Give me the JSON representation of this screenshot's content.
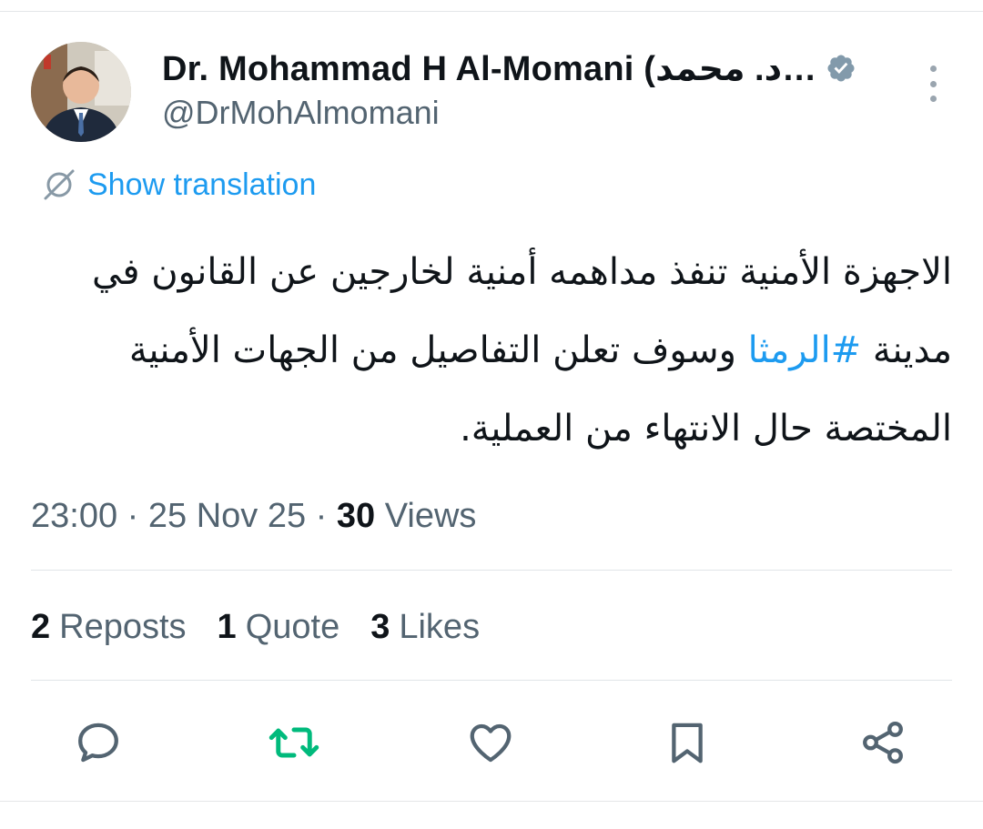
{
  "author": {
    "name": "Dr. Mohammad H Al-Momani (د. محمد…",
    "handle": "@DrMohAlmomani",
    "verified_icon": "verified-badge-icon"
  },
  "translation": {
    "label": "Show translation",
    "icon": "translate-icon"
  },
  "tweet": {
    "line1": "الاجهزة الأمنية تنفذ مداهمه أمنية لخارجين عن القانون في",
    "line2_prefix": "مدينة ",
    "hashtag": "#الرمثا",
    "line2_suffix": " وسوف تعلن التفاصيل من  الجهات الأمنية",
    "line3": "المختصة حال الانتهاء من العملية."
  },
  "meta": {
    "time": "23:00",
    "separator": " · ",
    "date": "25 Nov 25",
    "views_count": "30",
    "views_label": " Views"
  },
  "stats": {
    "reposts_count": "2",
    "reposts_label": "Reposts",
    "quotes_count": "1",
    "quotes_label": "Quote",
    "likes_count": "3",
    "likes_label": "Likes"
  },
  "actions": {
    "reply_icon": "reply-icon",
    "repost_icon": "repost-icon",
    "like_icon": "like-icon",
    "bookmark_icon": "bookmark-icon",
    "share_icon": "share-icon",
    "repost_active_color": "#00ba7c",
    "icon_color": "#536471"
  },
  "colors": {
    "accent": "#1d9bf0",
    "text_primary": "#0f1419",
    "text_secondary": "#536471",
    "verified_badge": "#829aab"
  }
}
